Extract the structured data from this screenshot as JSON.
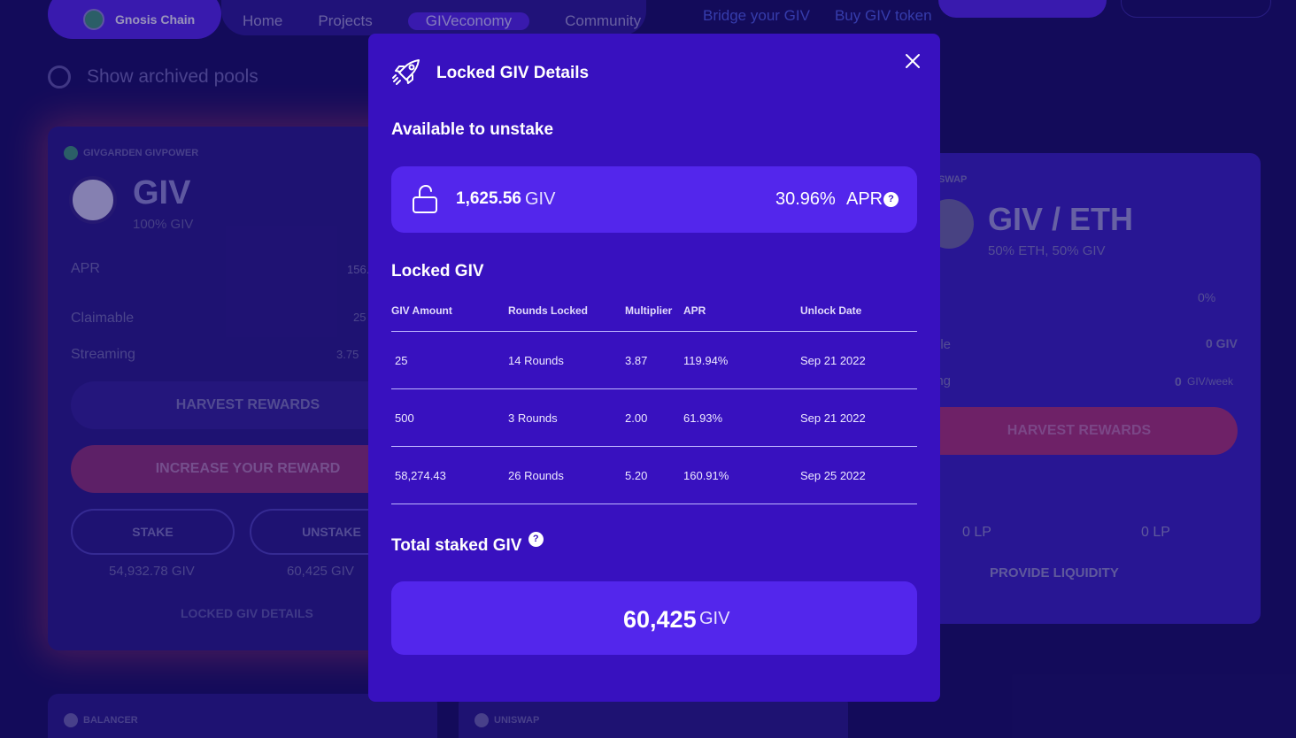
{
  "background": {
    "chain_pill": "Gnosis Chain",
    "nav": [
      "Home",
      "Projects",
      "GIVeconomy",
      "Community"
    ],
    "top_links": [
      "Bridge your GIV",
      "Buy GIV token"
    ],
    "archived_label": "Show archived pools",
    "left_card": {
      "platform": "GIVGARDEN GIVPOWER",
      "token": "GIV",
      "token_sub": "100% GIV",
      "apr_label": "APR",
      "apr_value": "156.",
      "claimable_label": "Claimable",
      "claimable_value": "25",
      "streaming_label": "Streaming",
      "streaming_value": "3.75",
      "harvest": "HARVEST REWARDS",
      "increase": "INCREASE YOUR REWARD",
      "stake": "STAKE",
      "unstake": "UNSTAKE",
      "stake_amount": "54,932.78 GIV",
      "unstake_amount": "60,425 GIV",
      "locked_details": "LOCKED GIV DETAILS"
    },
    "right_card": {
      "platform": "SWAP",
      "token": "GIV / ETH",
      "token_sub": "50% ETH, 50% GIV",
      "apr_value": "0%",
      "claimable_partial": "ble",
      "claimable_value": "0 GIV",
      "streaming_partial": "ing",
      "streaming_value": "0",
      "streaming_unit": "GIV/week",
      "harvest": "HARVEST REWARDS",
      "lp_left": "0 LP",
      "lp_right": "0 LP",
      "provide": "PROVIDE LIQUIDITY"
    },
    "bottom_cards": [
      "BALANCER",
      "UNISWAP"
    ]
  },
  "modal": {
    "title": "Locked GIV Details",
    "available_title": "Available to unstake",
    "available_amount": "1,625.56",
    "available_unit": "GIV",
    "available_pct": "30.96%",
    "available_apr_label": "APR",
    "help_mark": "?",
    "locked_title": "Locked GIV",
    "table_headers": [
      "GIV Amount",
      "Rounds Locked",
      "Multiplier",
      "APR",
      "Unlock Date"
    ],
    "rows": [
      [
        "25",
        "14 Rounds",
        "3.87",
        "119.94%",
        "Sep 21 2022"
      ],
      [
        "500",
        "3 Rounds",
        "2.00",
        "61.93%",
        "Sep 21 2022"
      ],
      [
        "58,274.43",
        "26 Rounds",
        "5.20",
        "160.91%",
        "Sep 25 2022"
      ]
    ],
    "total_title": "Total staked GIV",
    "total_amount": "60,425",
    "total_unit": "GIV"
  }
}
